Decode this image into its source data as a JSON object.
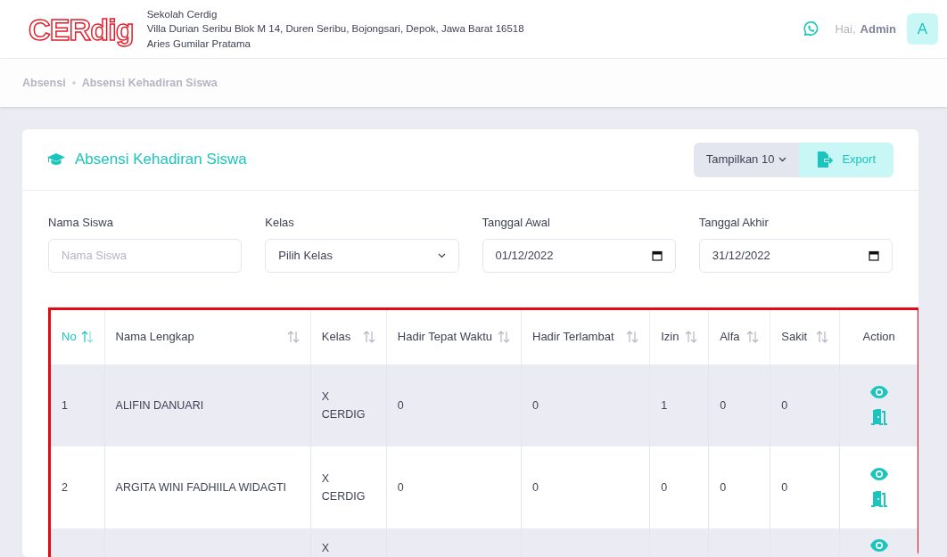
{
  "header": {
    "logo": "CERdig",
    "school_name": "Sekolah Cerdig",
    "address": "Villa Durian Seribu Blok M 14, Duren Seribu, Bojongsari, Depok, Jawa Barat 16518",
    "principal": "Aries Gumilar Pratama",
    "greeting": "Hai,",
    "user": "Admin",
    "avatar": "A"
  },
  "breadcrumb": [
    {
      "label": "Absensi"
    },
    {
      "label": "Absensi Kehadiran Siswa"
    }
  ],
  "card": {
    "title": "Absensi Kehadiran Siswa",
    "page_size_button": "Tampilkan 10",
    "export_button": "Export"
  },
  "filters": [
    {
      "kind": "text",
      "label": "Nama Siswa",
      "placeholder": "Nama Siswa"
    },
    {
      "kind": "select",
      "label": "Kelas",
      "value": "Pilih Kelas"
    },
    {
      "kind": "date",
      "label": "Tanggal Awal",
      "value": "01/12/2022"
    },
    {
      "kind": "date",
      "label": "Tanggal Akhir",
      "value": "31/12/2022"
    }
  ],
  "table": {
    "columns": [
      {
        "label": "No",
        "sortable": true,
        "sorted": true
      },
      {
        "label": "Nama Lengkap",
        "sortable": true,
        "sorted": false
      },
      {
        "label": "Kelas",
        "sortable": true,
        "sorted": false
      },
      {
        "label": "Hadir Tepat Waktu",
        "sortable": true,
        "sorted": false
      },
      {
        "label": "Hadir Terlambat",
        "sortable": true,
        "sorted": false
      },
      {
        "label": "Izin",
        "sortable": true,
        "sorted": false
      },
      {
        "label": "Alfa",
        "sortable": true,
        "sorted": false
      },
      {
        "label": "Sakit",
        "sortable": true,
        "sorted": false
      },
      {
        "label": "Action",
        "sortable": false,
        "sorted": false
      }
    ],
    "rows": [
      {
        "cells": [
          "1",
          "ALIFIN DANUARI",
          "X CERDIG",
          "0",
          "0",
          "1",
          "0",
          "0"
        ]
      },
      {
        "cells": [
          "2",
          "ARGITA WINI FADHIILA WIDAGTI",
          "X CERDIG",
          "0",
          "0",
          "0",
          "0",
          "0"
        ]
      },
      {
        "cells": [
          "",
          "",
          "X",
          "",
          "",
          "",
          "",
          ""
        ]
      }
    ]
  }
}
